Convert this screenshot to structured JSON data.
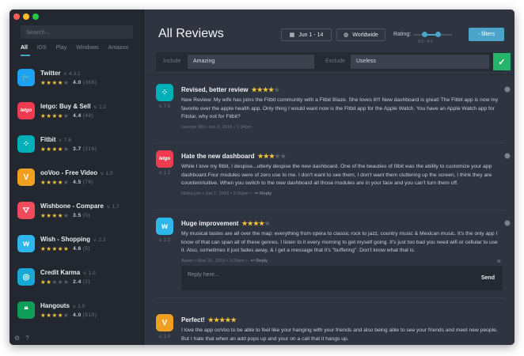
{
  "sidebar": {
    "search_placeholder": "Search...",
    "platform_tabs": [
      "All",
      "iOS",
      "Play",
      "Windows",
      "Amazon"
    ],
    "apps": [
      {
        "name": "Twitter",
        "version": "v. 4.3.1",
        "stars": 4,
        "rating": "4.0",
        "count": "(356)",
        "icon": "twitter-bird-icon",
        "color": "#1da1f2",
        "glyph": "🐦"
      },
      {
        "name": "letgo: Buy & Sell",
        "version": "v. 1.2",
        "stars": 4,
        "rating": "4.4",
        "count": "(48)",
        "icon": "letgo-icon",
        "color": "#ee3b4f",
        "glyph": "letgo"
      },
      {
        "name": "Fitbit",
        "version": "v. 7.6",
        "stars": 4,
        "rating": "3.7",
        "count": "(216)",
        "icon": "fitbit-icon",
        "color": "#00b0b9",
        "glyph": "⁘"
      },
      {
        "name": "ooVoo - Free Video",
        "version": "v. 1.0",
        "stars": 4,
        "rating": "4.5",
        "count": "(76)",
        "icon": "oovoo-icon",
        "color": "#f0a020",
        "glyph": "V"
      },
      {
        "name": "Wishbone - Compare",
        "version": "v. 1.7",
        "stars": 4,
        "rating": "3.5",
        "count": "(0)",
        "icon": "wishbone-icon",
        "color": "#ef4b5a",
        "glyph": "⛛"
      },
      {
        "name": "Wish - Shopping",
        "version": "v. 2.2",
        "stars": 5,
        "rating": "4.6",
        "count": "(5)",
        "icon": "wish-icon",
        "color": "#2fb7ec",
        "glyph": "w"
      },
      {
        "name": "Credit Karma",
        "version": "v. 1.0",
        "stars": 2,
        "rating": "2.4",
        "count": "(2)",
        "icon": "credit-karma-icon",
        "color": "#18a8d8",
        "glyph": "◎"
      },
      {
        "name": "Hangouts",
        "version": "v. 1.0",
        "stars": 4,
        "rating": "4.0",
        "count": "(510)",
        "icon": "hangouts-icon",
        "color": "#0f9d58",
        "glyph": "❝"
      }
    ]
  },
  "header": {
    "title": "All Reviews",
    "date_range": "Jun 1 - 14",
    "region": "Worldwide",
    "rating_label": "Rating:",
    "rating_range_min": "3.0",
    "rating_range_max": "4.0",
    "rating_range_text": "3.0 - 4.0",
    "filters_button": "- filters"
  },
  "filter": {
    "include_label": "Include",
    "include_value": "Amazing",
    "exclude_label": "Exclude",
    "exclude_value": "Useless"
  },
  "reviews": [
    {
      "title": "Revised, better review",
      "stars": 4,
      "icon": "fitbit-icon",
      "color": "#00b0b9",
      "glyph": "⁘",
      "version": "v. 7.6",
      "platform": "android-icon",
      "body": "New Review: My wife has joins the Fitbit community with a Fitbit Blaze. She loves it!!! New dashboard is great! The Fitbit app is now my favorite over the apple health app. Only thing I would want now is the Fitbit app for the Apple Watch. You have an Apple Watch app for Fitstar, why not for Fitbit?",
      "meta": "George Wil • Jun 2, 2016 • 1:34pm",
      "reply": ""
    },
    {
      "title": "Hate the new dashboard",
      "stars": 3,
      "icon": "letgo-icon",
      "color": "#ee3b4f",
      "glyph": "letgo",
      "version": "v. 1.2",
      "platform": "android-icon",
      "body": "While I love my fitbit, I despise...utterly despise the new dashboard. One of the beauties of fitbit was the ability to customize your app dashboard.Four modules were of zero use to me. I don't want to see them, I don't want them cluttering up the screen, I think they are counterintuitive. When you switch to the new dashboard all those modules are in your face and you can't turn them off.",
      "meta": "NikkiLynn • Jun 1, 2016 • 5:20pm •",
      "reply": "Reply"
    },
    {
      "title": "Huge improvement",
      "stars": 4,
      "icon": "wish-icon",
      "color": "#2fb7ec",
      "glyph": "w",
      "version": "v. 2.2",
      "platform": "android-icon",
      "body": "My musical tastes are all over the map: everything from opera to classic rock to jazz, country music & Mexican music. It's the only app I know of that can span all of these genres. I listen to it every morning to get myself going. It's just too bad you need wifi or cellular to use it. Also, sometimes it just fades away, & I get a message that it's \"buffering\". Don't know what that is.",
      "meta": "Adam • May 31, 2016 • 3:25pm •",
      "reply": "Reply"
    },
    {
      "title": "Perfect!",
      "stars": 5,
      "icon": "oovoo-icon",
      "color": "#f0a020",
      "glyph": "V",
      "version": "v. 1.0",
      "platform": "apple-icon",
      "body": "I love the app ooVoo to be able to feel like your hanging with your friends and also being able to see your friends and meet new people. But I hate that when an add pops up and your on a call that it hangs up.",
      "meta": "",
      "reply": ""
    }
  ],
  "reply_box": {
    "placeholder": "Reply here...",
    "send_label": "Send"
  },
  "colors": {
    "accent": "#4ba4c9",
    "confirm": "#26b36a",
    "star": "#f3c23c"
  }
}
